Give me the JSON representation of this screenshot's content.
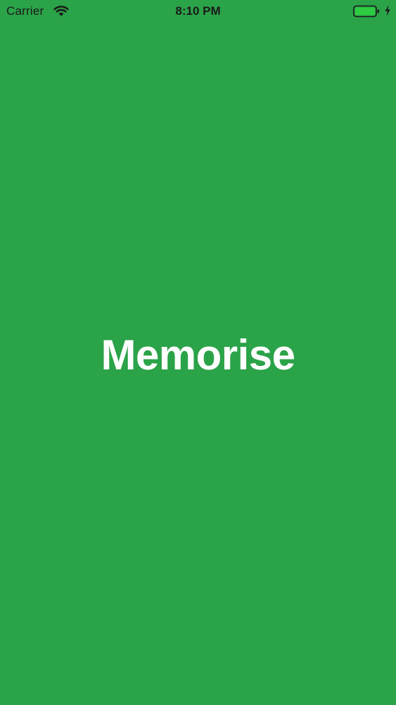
{
  "status_bar": {
    "carrier": "Carrier",
    "time": "8:10 PM",
    "icons": [
      "wifi-icon",
      "battery-icon",
      "charging-bolt-icon"
    ],
    "battery_level": 1.0,
    "battery_color": "#2ecc40"
  },
  "splash": {
    "title": "Memorise",
    "background_color": "#2ba349",
    "title_color": "#ffffff"
  }
}
